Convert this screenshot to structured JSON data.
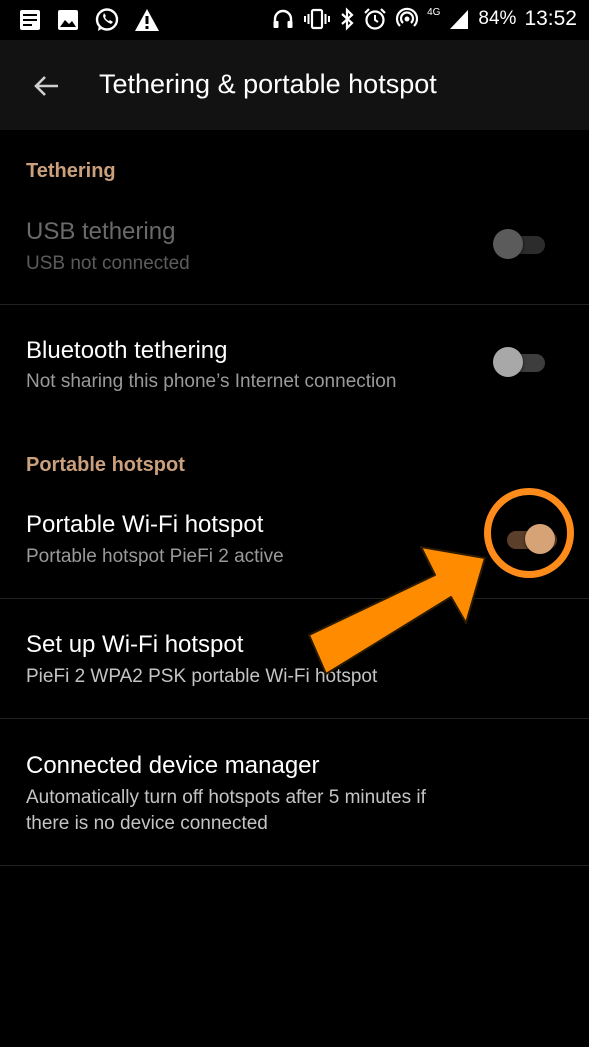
{
  "status_bar": {
    "battery": "84%",
    "time": "13:52",
    "network": "4G",
    "left_icons": [
      "notes-icon",
      "image-icon",
      "whatsapp-icon",
      "warning-icon"
    ],
    "right_icons": [
      "headphones-icon",
      "vibrate-icon",
      "bluetooth-icon",
      "alarm-icon",
      "hotspot-icon",
      "signal-icon"
    ]
  },
  "app_bar": {
    "title": "Tethering & portable hotspot",
    "back_icon": "back-arrow-icon"
  },
  "sections": {
    "tethering": "Tethering",
    "hotspot": "Portable hotspot"
  },
  "rows": {
    "usb": {
      "title": "USB tethering",
      "subtitle": "USB not connected",
      "enabled": false,
      "on": false
    },
    "bluetooth": {
      "title": "Bluetooth tethering",
      "subtitle": "Not sharing this phone’s Internet connection",
      "enabled": true,
      "on": false
    },
    "wifi_hotspot": {
      "title": "Portable Wi-Fi hotspot",
      "subtitle": "Portable hotspot PieFi 2 active",
      "enabled": true,
      "on": true
    },
    "setup": {
      "title": "Set up Wi-Fi hotspot",
      "subtitle": "PieFi 2 WPA2 PSK portable Wi-Fi hotspot"
    },
    "device_manager": {
      "title": "Connected device manager",
      "subtitle_line1": "Automatically turn off hotspots after 5 minutes if",
      "subtitle_line2": "there is no device connected"
    }
  },
  "colors": {
    "accent": "#caa07d",
    "annotation": "#ff8c1a",
    "background": "#000000",
    "app_bar": "#121212"
  },
  "annotation": {
    "type": "arrow-and-circle",
    "target": "wifi-hotspot-switch"
  }
}
